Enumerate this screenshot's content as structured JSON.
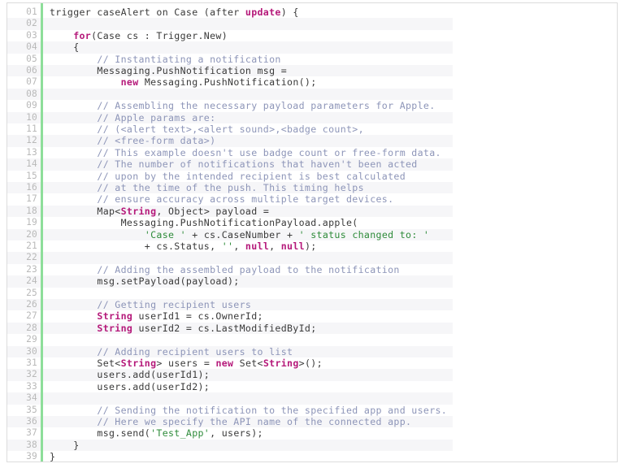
{
  "editor": {
    "name": "code-snippet-viewer",
    "language": "Apex",
    "first_line_number": 1,
    "last_line_number": 39,
    "total_lines": 39,
    "colors": {
      "background": "#ffffff",
      "stripe": "#f6f6f8",
      "border": "#dcdcdc",
      "gutter_text": "#b9b9b9",
      "gutter_bar": "#8ede9a",
      "plain_text": "#3a3a3a",
      "keyword": "#b5197a",
      "comment": "#8d95b8",
      "string": "#2e8b3a"
    }
  },
  "lines": [
    {
      "num": "01",
      "tokens": [
        {
          "t": "pln",
          "s": "trigger caseAlert on Case (after "
        },
        {
          "t": "kw",
          "s": "update"
        },
        {
          "t": "pln",
          "s": ") {"
        }
      ]
    },
    {
      "num": "02",
      "tokens": []
    },
    {
      "num": "03",
      "tokens": [
        {
          "t": "pln",
          "s": "    "
        },
        {
          "t": "kw",
          "s": "for"
        },
        {
          "t": "pln",
          "s": "(Case cs : Trigger.New)"
        }
      ]
    },
    {
      "num": "04",
      "tokens": [
        {
          "t": "pln",
          "s": "    {"
        }
      ]
    },
    {
      "num": "05",
      "tokens": [
        {
          "t": "cmt",
          "s": "        // Instantiating a notification"
        }
      ]
    },
    {
      "num": "06",
      "tokens": [
        {
          "t": "pln",
          "s": "        Messaging.PushNotification msg ="
        }
      ]
    },
    {
      "num": "07",
      "tokens": [
        {
          "t": "pln",
          "s": "            "
        },
        {
          "t": "kw",
          "s": "new"
        },
        {
          "t": "pln",
          "s": " Messaging.PushNotification();"
        }
      ]
    },
    {
      "num": "08",
      "tokens": []
    },
    {
      "num": "09",
      "tokens": [
        {
          "t": "cmt",
          "s": "        // Assembling the necessary payload parameters for Apple."
        }
      ]
    },
    {
      "num": "10",
      "tokens": [
        {
          "t": "cmt",
          "s": "        // Apple params are:"
        }
      ]
    },
    {
      "num": "11",
      "tokens": [
        {
          "t": "cmt",
          "s": "        // (<alert text>,<alert sound>,<badge count>,"
        }
      ]
    },
    {
      "num": "12",
      "tokens": [
        {
          "t": "cmt",
          "s": "        // <free-form data>)"
        }
      ]
    },
    {
      "num": "13",
      "tokens": [
        {
          "t": "cmt",
          "s": "        // This example doesn't use badge count or free-form data."
        }
      ]
    },
    {
      "num": "14",
      "tokens": [
        {
          "t": "cmt",
          "s": "        // The number of notifications that haven't been acted"
        }
      ]
    },
    {
      "num": "15",
      "tokens": [
        {
          "t": "cmt",
          "s": "        // upon by the intended recipient is best calculated"
        }
      ]
    },
    {
      "num": "16",
      "tokens": [
        {
          "t": "cmt",
          "s": "        // at the time of the push. This timing helps"
        }
      ]
    },
    {
      "num": "17",
      "tokens": [
        {
          "t": "cmt",
          "s": "        // ensure accuracy across multiple target devices."
        }
      ]
    },
    {
      "num": "18",
      "tokens": [
        {
          "t": "pln",
          "s": "        Map<"
        },
        {
          "t": "kw",
          "s": "String"
        },
        {
          "t": "pln",
          "s": ", Object> payload ="
        }
      ]
    },
    {
      "num": "19",
      "tokens": [
        {
          "t": "pln",
          "s": "            Messaging.PushNotificationPayload.apple("
        }
      ]
    },
    {
      "num": "20",
      "tokens": [
        {
          "t": "pln",
          "s": "                "
        },
        {
          "t": "str",
          "s": "'Case '"
        },
        {
          "t": "pln",
          "s": " + cs.CaseNumber + "
        },
        {
          "t": "str",
          "s": "' status changed to: '"
        }
      ]
    },
    {
      "num": "21",
      "tokens": [
        {
          "t": "pln",
          "s": "                + cs.Status, "
        },
        {
          "t": "str",
          "s": "''"
        },
        {
          "t": "pln",
          "s": ", "
        },
        {
          "t": "kw",
          "s": "null"
        },
        {
          "t": "pln",
          "s": ", "
        },
        {
          "t": "kw",
          "s": "null"
        },
        {
          "t": "pln",
          "s": ");"
        }
      ]
    },
    {
      "num": "22",
      "tokens": []
    },
    {
      "num": "23",
      "tokens": [
        {
          "t": "cmt",
          "s": "        // Adding the assembled payload to the notification"
        }
      ]
    },
    {
      "num": "24",
      "tokens": [
        {
          "t": "pln",
          "s": "        msg.setPayload(payload);"
        }
      ]
    },
    {
      "num": "25",
      "tokens": []
    },
    {
      "num": "26",
      "tokens": [
        {
          "t": "cmt",
          "s": "        // Getting recipient users"
        }
      ]
    },
    {
      "num": "27",
      "tokens": [
        {
          "t": "kw",
          "s": "        String"
        },
        {
          "t": "pln",
          "s": " userId1 = cs.OwnerId;"
        }
      ]
    },
    {
      "num": "28",
      "tokens": [
        {
          "t": "kw",
          "s": "        String"
        },
        {
          "t": "pln",
          "s": " userId2 = cs.LastModifiedById;"
        }
      ]
    },
    {
      "num": "29",
      "tokens": []
    },
    {
      "num": "30",
      "tokens": [
        {
          "t": "cmt",
          "s": "        // Adding recipient users to list"
        }
      ]
    },
    {
      "num": "31",
      "tokens": [
        {
          "t": "pln",
          "s": "        Set<"
        },
        {
          "t": "kw",
          "s": "String"
        },
        {
          "t": "pln",
          "s": "> users = "
        },
        {
          "t": "kw",
          "s": "new"
        },
        {
          "t": "pln",
          "s": " Set<"
        },
        {
          "t": "kw",
          "s": "String"
        },
        {
          "t": "pln",
          "s": ">();"
        }
      ]
    },
    {
      "num": "32",
      "tokens": [
        {
          "t": "pln",
          "s": "        users.add(userId1);"
        }
      ]
    },
    {
      "num": "33",
      "tokens": [
        {
          "t": "pln",
          "s": "        users.add(userId2);"
        }
      ]
    },
    {
      "num": "34",
      "tokens": []
    },
    {
      "num": "35",
      "tokens": [
        {
          "t": "cmt",
          "s": "        // Sending the notification to the specified app and users."
        }
      ]
    },
    {
      "num": "36",
      "tokens": [
        {
          "t": "cmt",
          "s": "        // Here we specify the API name of the connected app."
        }
      ]
    },
    {
      "num": "37",
      "tokens": [
        {
          "t": "pln",
          "s": "        msg.send("
        },
        {
          "t": "str",
          "s": "'Test_App'"
        },
        {
          "t": "pln",
          "s": ", users);"
        }
      ]
    },
    {
      "num": "38",
      "tokens": [
        {
          "t": "pln",
          "s": "    }"
        }
      ]
    },
    {
      "num": "39",
      "tokens": [
        {
          "t": "pln",
          "s": "}"
        }
      ]
    }
  ]
}
